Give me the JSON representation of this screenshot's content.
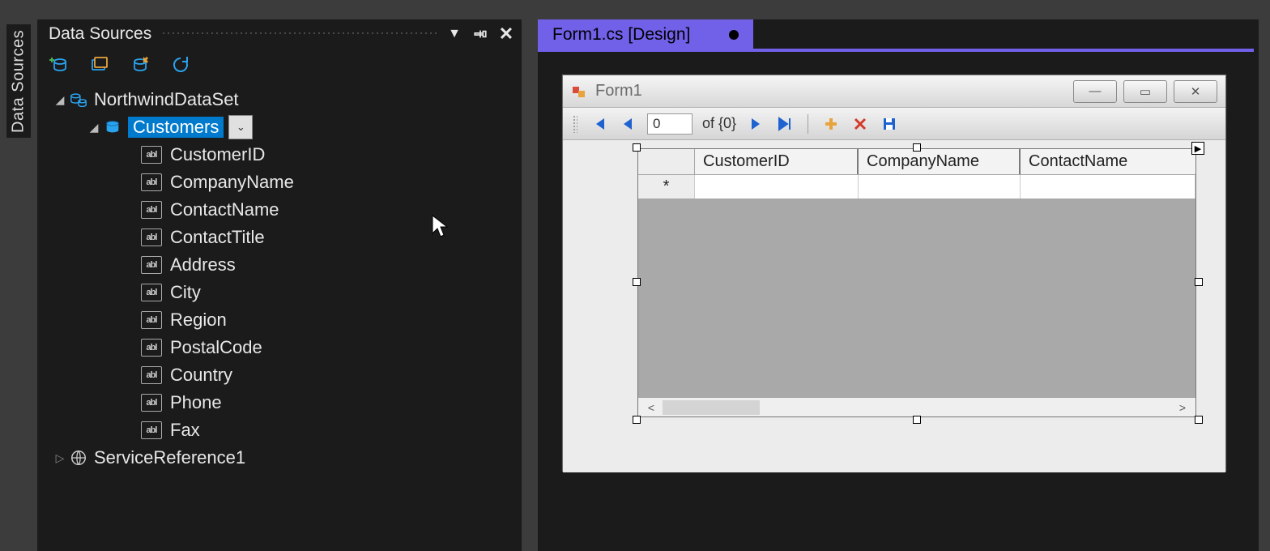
{
  "sidebar_tab": "Data Sources",
  "panel": {
    "title": "Data Sources",
    "tree": {
      "root": "NorthwindDataSet",
      "selected_table": "Customers",
      "fields": [
        "CustomerID",
        "CompanyName",
        "ContactName",
        "ContactTitle",
        "Address",
        "City",
        "Region",
        "PostalCode",
        "Country",
        "Phone",
        "Fax"
      ],
      "sibling": "ServiceReference1"
    }
  },
  "document_tab": "Form1.cs [Design]",
  "form": {
    "title": "Form1",
    "nav": {
      "position": "0",
      "of_label": "of {0}"
    },
    "grid": {
      "columns": [
        "CustomerID",
        "CompanyName",
        "ContactName"
      ],
      "newrow_marker": "*"
    }
  }
}
